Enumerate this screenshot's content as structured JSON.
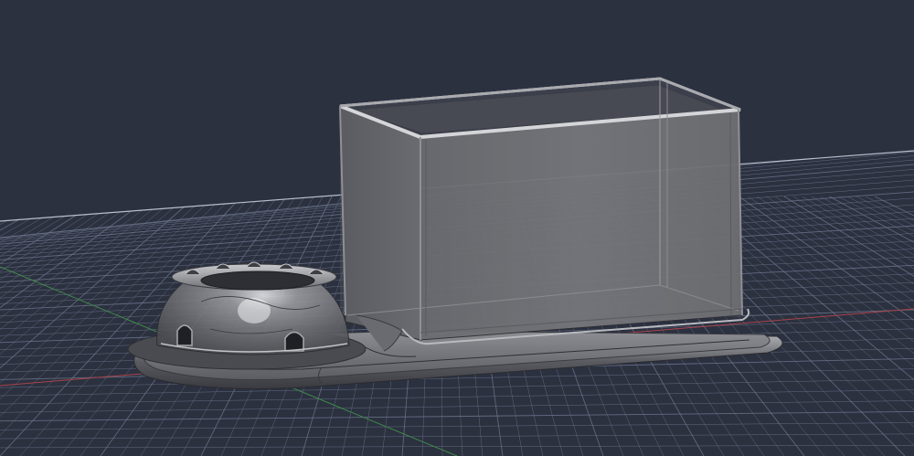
{
  "viewport": {
    "background": "#2c3140",
    "grid_color": "#6f7a90",
    "x_axis_color": "#a8434a",
    "y_axis_color": "#3f8a4a"
  },
  "model": {
    "parts": [
      "tray-base",
      "box-enclosure",
      "dome-holder"
    ],
    "body_color": "#7e7f84",
    "glass_color": "#8a8b90"
  }
}
